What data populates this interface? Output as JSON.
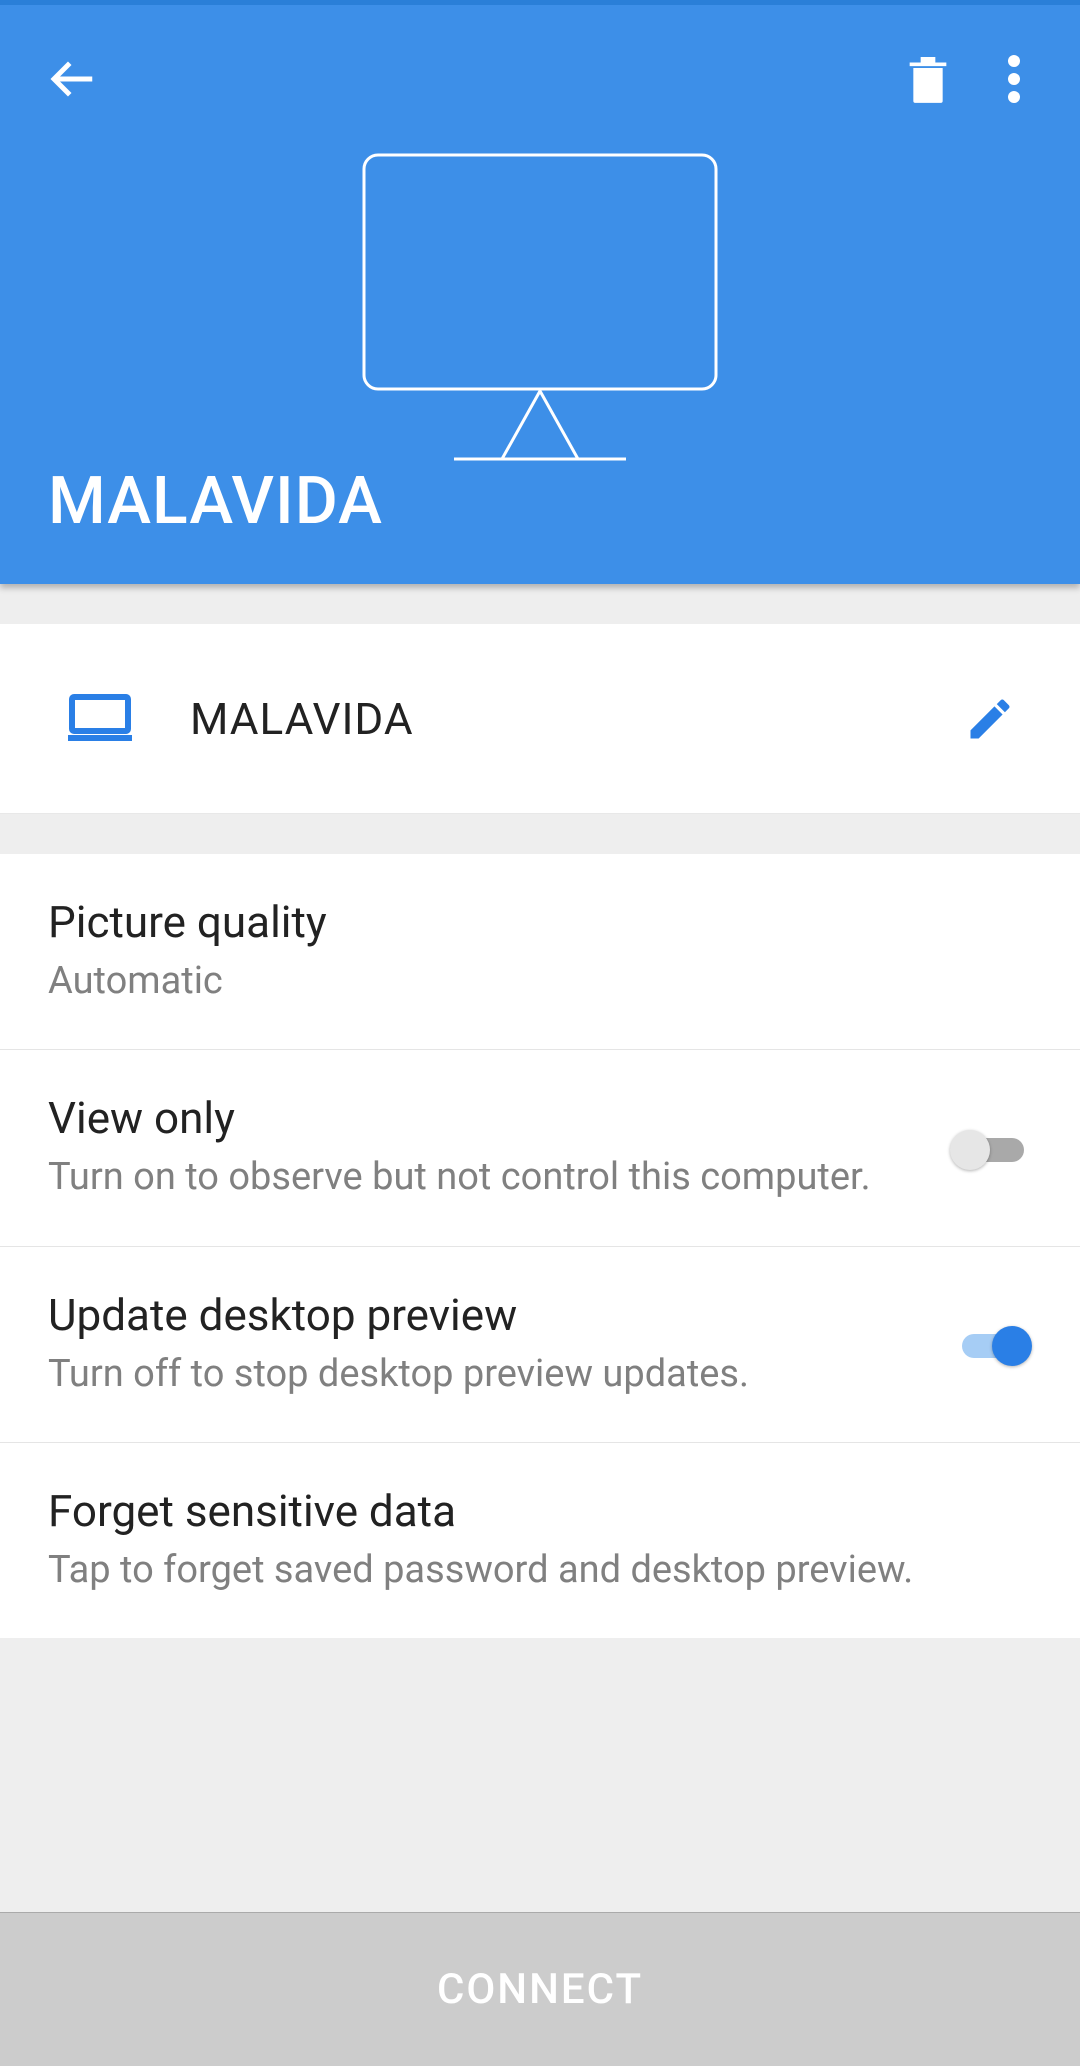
{
  "header": {
    "title": "MALAVIDA"
  },
  "device": {
    "name": "MALAVIDA"
  },
  "settings": {
    "picture_quality": {
      "title": "Picture quality",
      "value": "Automatic"
    },
    "view_only": {
      "title": "View only",
      "sub": "Turn on to observe but not control this computer.",
      "enabled": false
    },
    "update_preview": {
      "title": "Update desktop preview",
      "sub": "Turn off to stop desktop preview updates.",
      "enabled": true
    },
    "forget": {
      "title": "Forget sensitive data",
      "sub": "Tap to forget saved password and desktop preview."
    }
  },
  "footer": {
    "connect_label": "CONNECT"
  }
}
